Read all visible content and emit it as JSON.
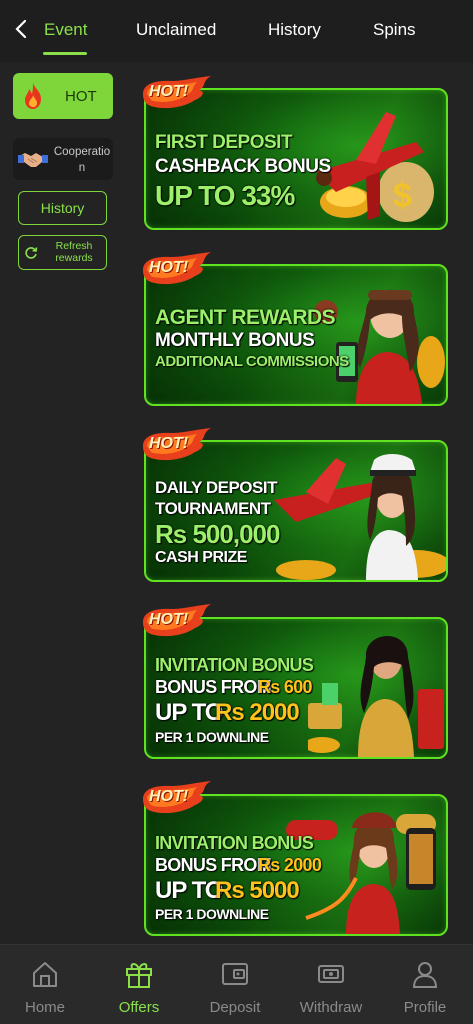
{
  "header": {
    "tabs": [
      {
        "label": "Event",
        "active": true
      },
      {
        "label": "Unclaimed",
        "active": false
      },
      {
        "label": "History",
        "active": false
      },
      {
        "label": "Spins",
        "active": false
      }
    ]
  },
  "sidebar": {
    "hot_label": "HOT",
    "cooperation_label": "Cooperation",
    "history_label": "History",
    "refresh_label": "Refresh rewards"
  },
  "badge_text": "HOT!",
  "banners": [
    {
      "lines": [
        "FIRST DEPOSIT",
        "CASHBACK BONUS",
        "UP TO 33%"
      ]
    },
    {
      "lines": [
        "AGENT REWARDS",
        "MONTHLY BONUS",
        "ADDITIONAL COMMISSIONS"
      ]
    },
    {
      "lines": [
        "DAILY DEPOSIT",
        "TOURNAMENT",
        "Rs 500,000",
        "CASH PRIZE"
      ]
    },
    {
      "lines": [
        "INVITATION BONUS",
        "BONUS FROM",
        "Rs 600",
        "UP TO",
        "Rs 2000",
        "PER 1 DOWNLINE"
      ]
    },
    {
      "lines": [
        "INVITATION BONUS",
        "BONUS FROM",
        "Rs 2000",
        "UP TO",
        "Rs 5000",
        "PER 1 DOWNLINE"
      ]
    }
  ],
  "bottom_nav": [
    {
      "label": "Home",
      "icon": "home-icon",
      "active": false
    },
    {
      "label": "Offers",
      "icon": "gift-icon",
      "active": true
    },
    {
      "label": "Deposit",
      "icon": "wallet-icon",
      "active": false
    },
    {
      "label": "Withdraw",
      "icon": "withdraw-icon",
      "active": false
    },
    {
      "label": "Profile",
      "icon": "profile-icon",
      "active": false
    }
  ],
  "colors": {
    "accent": "#8be04a",
    "background": "#232323",
    "card_border": "#5fe21f",
    "gold": "#ffc21a"
  }
}
